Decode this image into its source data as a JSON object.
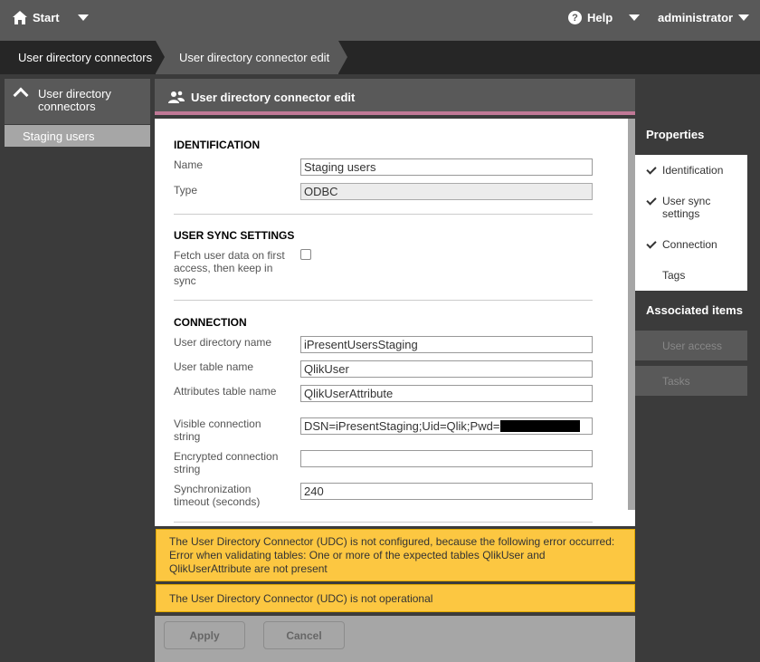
{
  "topbar": {
    "start_label": "Start",
    "help_label": "Help",
    "help_symbol": "?",
    "user_label": "administrator"
  },
  "breadcrumb": {
    "items": [
      "User directory connectors",
      "User directory connector edit"
    ]
  },
  "leftnav": {
    "header": "User directory connectors",
    "items": [
      "Staging users"
    ]
  },
  "main": {
    "title": "User directory connector edit"
  },
  "form": {
    "identification": {
      "title": "IDENTIFICATION",
      "name_label": "Name",
      "name_value": "Staging users",
      "type_label": "Type",
      "type_value": "ODBC"
    },
    "user_sync": {
      "title": "USER SYNC SETTINGS",
      "fetch_label": "Fetch user data on first access, then keep in sync",
      "fetch_checked": false
    },
    "connection": {
      "title": "CONNECTION",
      "user_dir_label": "User directory name",
      "user_dir_value": "iPresentUsersStaging",
      "user_table_label": "User table name",
      "user_table_value": "QlikUser",
      "attr_table_label": "Attributes table name",
      "attr_table_value": "QlikUserAttribute",
      "visible_conn_label": "Visible connection string",
      "visible_conn_value": "DSN=iPresentStaging;Uid=Qlik;Pwd=",
      "encrypted_conn_label": "Encrypted connection string",
      "encrypted_conn_value": "",
      "sync_timeout_label": "Synchronization timeout (seconds)",
      "sync_timeout_value": "240"
    }
  },
  "alerts": [
    "The User Directory Connector (UDC) is not configured, because the following error occurred: Error when validating tables: One or more of the expected tables QlikUser and QlikUserAttribute are not present",
    "The User Directory Connector (UDC) is not operational"
  ],
  "footer": {
    "apply_label": "Apply",
    "cancel_label": "Cancel"
  },
  "properties": {
    "title": "Properties",
    "items": [
      "Identification",
      "User sync settings",
      "Connection",
      "Tags"
    ],
    "associated_title": "Associated items",
    "associated_items": [
      "User access",
      "Tasks"
    ]
  },
  "colors": {
    "accent": "#c07896",
    "alert": "#fcc741",
    "dark": "#262626",
    "mid": "#595959"
  }
}
